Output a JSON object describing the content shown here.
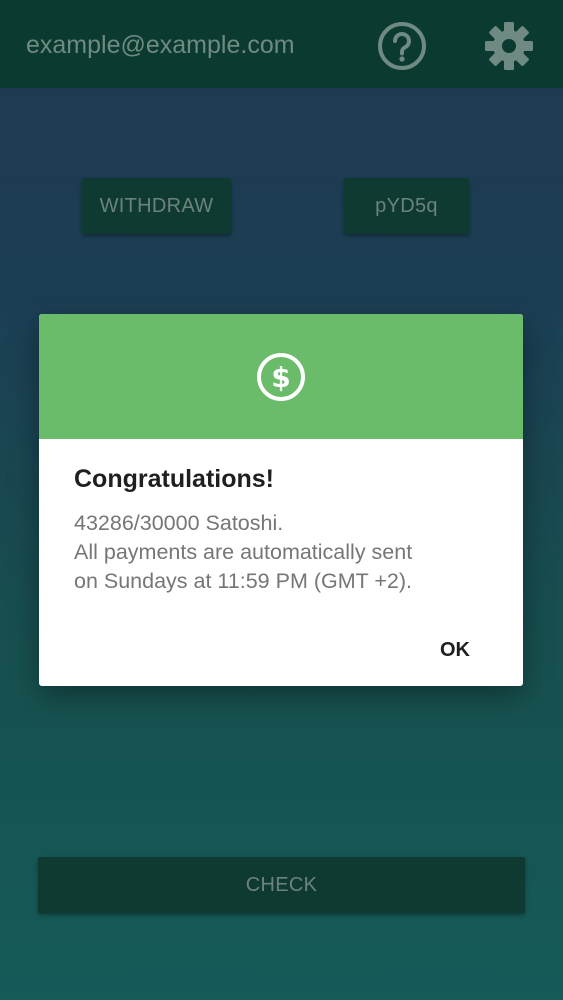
{
  "appbar": {
    "email": "example@example.com",
    "help_icon": "help-circle-icon",
    "settings_icon": "gear-icon"
  },
  "main": {
    "withdraw_label": "WITHDRAW",
    "code_label": "pYD5q",
    "check_label": "CHECK"
  },
  "dialog": {
    "icon": "dollar-circle-icon",
    "title": "Congratulations!",
    "message_line1": "43286/30000 Satoshi.",
    "message_line2": "All payments are automatically sent",
    "message_line3": "on Sundays at 11:59 PM (GMT +2).",
    "ok_label": "OK"
  },
  "colors": {
    "appbar_bg": "#0b3b30",
    "dialog_header": "#6abb6a",
    "button_bg": "#0e3a31"
  }
}
